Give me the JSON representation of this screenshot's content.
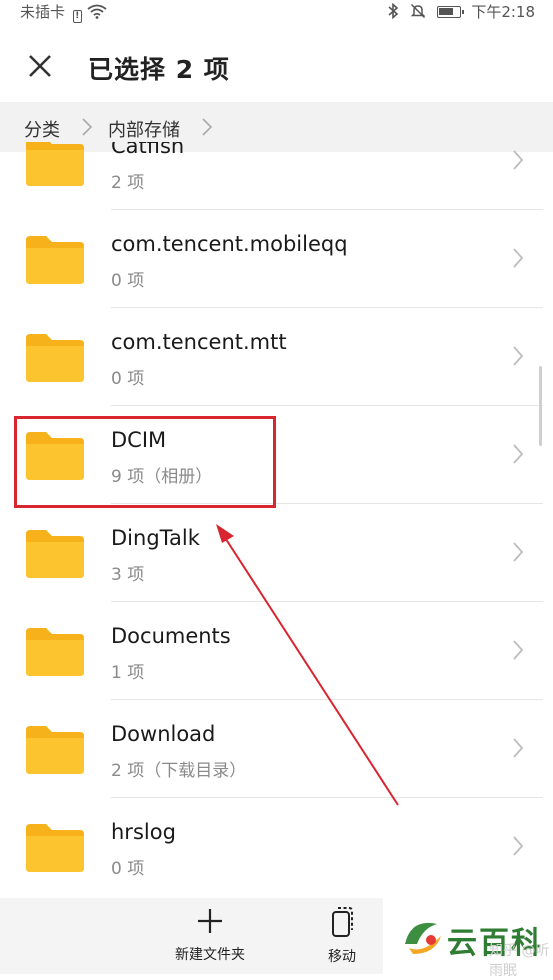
{
  "status_bar": {
    "carrier": "未插卡",
    "time": "下午2:18"
  },
  "header": {
    "title": "已选择 2 项"
  },
  "breadcrumb": {
    "items": [
      "分类",
      "内部存储"
    ]
  },
  "folders": [
    {
      "name": "Catfish",
      "sub": "2 项"
    },
    {
      "name": "com.tencent.mobileqq",
      "sub": "0 项"
    },
    {
      "name": "com.tencent.mtt",
      "sub": "0 项"
    },
    {
      "name": "DCIM",
      "sub": "9 项（相册）"
    },
    {
      "name": "DingTalk",
      "sub": "3 项"
    },
    {
      "name": "Documents",
      "sub": "1 项"
    },
    {
      "name": "Download",
      "sub": "2 项（下载目录）"
    },
    {
      "name": "hrslog",
      "sub": "0 项"
    }
  ],
  "bottom_bar": {
    "new_folder_label": "新建文件夹",
    "move_label": "移动"
  },
  "watermark": {
    "brand": "云百科",
    "source": "知乎 @听雨眠"
  },
  "colors": {
    "folder": "#fbbf24",
    "highlight": "#d8252f"
  }
}
